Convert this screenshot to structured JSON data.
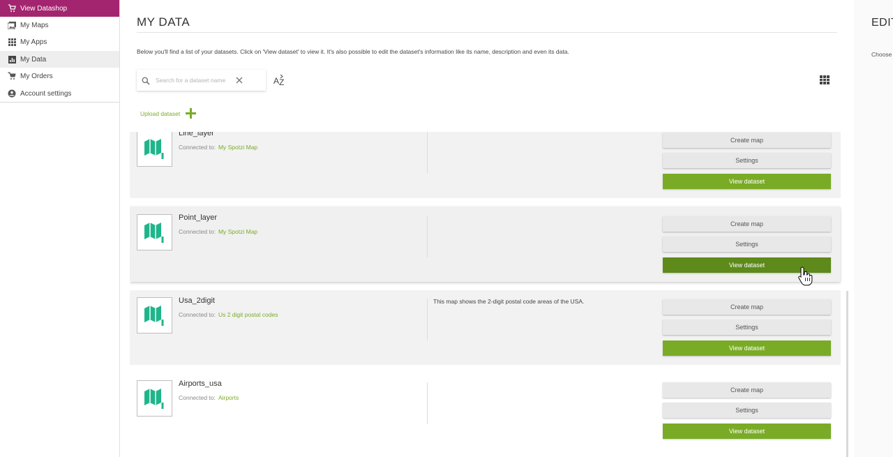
{
  "sidebar": {
    "items": [
      {
        "label": "View Datashop",
        "icon": "cart-icon"
      },
      {
        "label": "My Maps",
        "icon": "maps-icon"
      },
      {
        "label": "My Apps",
        "icon": "apps-grid-icon"
      },
      {
        "label": "My Data",
        "icon": "bar-chart-icon"
      },
      {
        "label": "My Orders",
        "icon": "cart-icon"
      },
      {
        "label": "Account settings",
        "icon": "user-circle-icon"
      }
    ]
  },
  "main": {
    "title": "MY DATA",
    "intro": "Below you'll find a list of your datasets. Click on 'View dataset' to view it. It's also possible to edit the dataset's information like its name, description and even its data.",
    "search": {
      "placeholder": "Search for a dataset name",
      "value": ""
    },
    "upload_label": "Upload dataset"
  },
  "connected_label": "Connected to:",
  "buttons": {
    "create_map": "Create map",
    "settings": "Settings",
    "view_dataset": "View dataset"
  },
  "datasets": [
    {
      "name": "Line_layer",
      "connected": "My Spotzi Map",
      "description": ""
    },
    {
      "name": "Point_layer",
      "connected": "My Spotzi Map",
      "description": ""
    },
    {
      "name": "Usa_2digit",
      "connected": "Us 2 digit postal codes",
      "description": "This map shows the 2-digit postal code areas of the USA."
    },
    {
      "name": "Airports_usa",
      "connected": "Airports",
      "description": ""
    }
  ],
  "right_panel": {
    "title": "EDIT",
    "subtitle": "Choose"
  },
  "colors": {
    "brand": "#a3256f",
    "accent_green": "#7aab26",
    "map_icon": "#1fb58a"
  }
}
